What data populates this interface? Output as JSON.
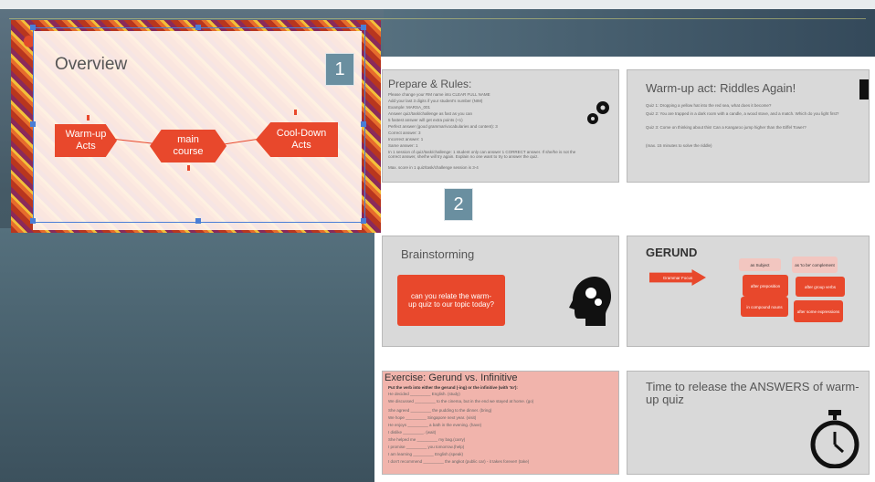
{
  "slides": {
    "overview": {
      "title": "Overview",
      "warmup": "Warm-up Acts",
      "main": "main course",
      "cooldown": "Cool-Down Acts",
      "badge": "1"
    },
    "badge2": "2",
    "prepare": {
      "title": "Prepare & Rules:",
      "lines": [
        "Please change your RM name into CLEAR FULL NAME",
        "Add your last 3 digits if your student's number (NIM)",
        "Example: MARSA_001",
        "Answer quiz/task/challenge as fast as you can",
        "5 fastest answer will get extra points (+1)",
        "Perfect answer (good grammar/vocabularies and content): 3",
        "Correct answer: 3",
        "Incorrect answer: 1",
        "Same answer: 1",
        "In 1 session of quiz/task/challenge: 1 student only can answer 1 CORRECT answer. If she/he is not the correct answer, she/he will try again. Explain no one want to try to answer the quiz.",
        "Max. score in 1 quiz/task/challenge session is 3-4"
      ]
    },
    "riddles": {
      "title": "Warm-up act: Riddles Again!",
      "lines": [
        "Quiz 1: Dropping a yellow hat into the red sea, what does it become?",
        "Quiz 2: You are trapped in a dark room with a candle, a wood stove, and a match. Which do you light first?",
        "Quiz 3: Come on thinking about this! Can a Kangaroo jump higher than the Eiffel Tower?",
        "(max. 15 minutes to solve the riddle)"
      ]
    },
    "brainstorming": {
      "title": "Brainstorming",
      "box": "can you relate the warm-up quiz to our topic today?"
    },
    "gerund": {
      "title": "GERUND",
      "arrow": "Grammar Focus",
      "subject": "as Subject",
      "complement": "as 'to be' complement",
      "b1": "after preposition",
      "b2": "after group verbs",
      "b3": "in compound nouns",
      "b4": "after some expressions"
    },
    "exercise": {
      "title": "Exercise: Gerund vs. Infinitive",
      "instruction": "Put the verb into either the gerund (-ing) or the infinitive (with 'to'):",
      "lines": [
        "He decided _________ English. (study)",
        "We discussed _________ to the cinema, but in the end we stayed at home. (go)",
        "She agreed _________ the pudding to the dinner. (bring)",
        "We hope _________ Singapore next year. (visit)",
        "He enjoys _________ a bath in the evening. (have)",
        "I dislike _________. (wait)",
        "She helped me _________ my bag.(carry)",
        "I promise _________ you tomorrow.(help)",
        "I am learning _________ English.(speak)",
        "I don't recommend _________ the angkot (public car) - it takes forever! (take)"
      ]
    },
    "answers": {
      "title": "Time to release the ANSWERS of warm-up quiz"
    }
  },
  "colors": {
    "accent": "#e8482c",
    "badge": "#6a8fa0",
    "slide_bg": "#d9d9d9"
  }
}
